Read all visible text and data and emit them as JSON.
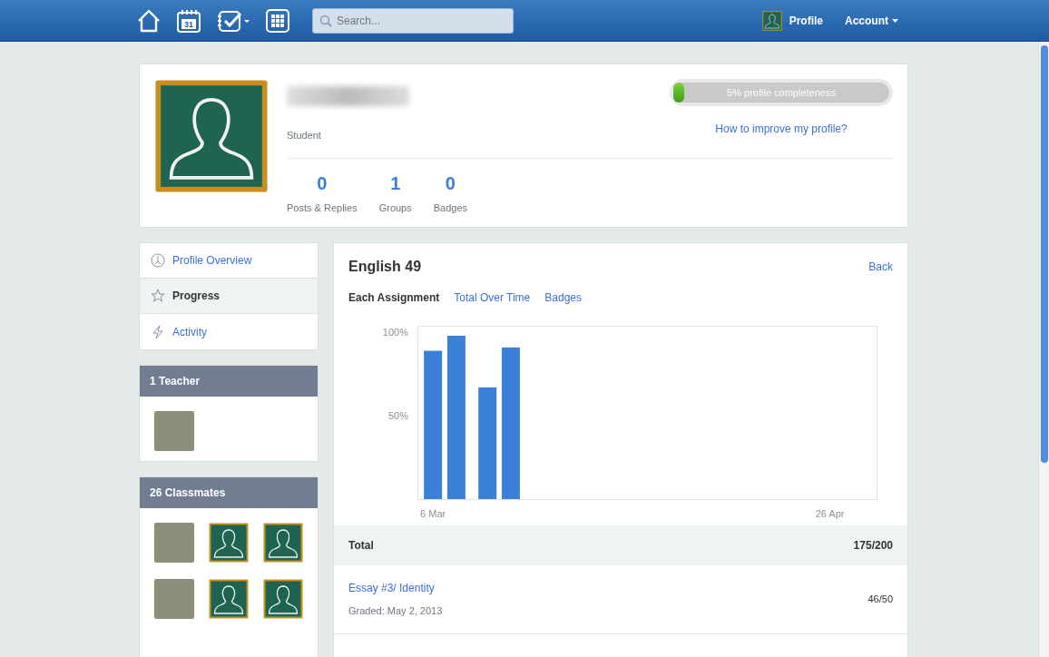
{
  "navbar": {
    "calendar_day": "31",
    "search": {
      "placeholder": "Search..."
    },
    "profile_label": "Profile",
    "account_label": "Account"
  },
  "profile": {
    "role": "Student",
    "completeness": {
      "label": "5% profile completeness",
      "level": 0.05
    },
    "improve_link": "How to improve my profile?",
    "stats": [
      {
        "value": "0",
        "label": "Posts & Replies"
      },
      {
        "value": "1",
        "label": "Groups"
      },
      {
        "value": "0",
        "label": "Badges"
      }
    ]
  },
  "sidebar": {
    "items": [
      {
        "label": "Profile Overview",
        "kind": "overview",
        "selected": false
      },
      {
        "label": "Progress",
        "kind": "progress",
        "selected": true
      },
      {
        "label": "Activity",
        "kind": "activity",
        "selected": false
      }
    ],
    "teachers": {
      "title": "1 Teacher",
      "members": [
        {
          "kind": "photo"
        }
      ]
    },
    "classmates": {
      "title": "26 Classmates",
      "members": [
        {
          "kind": "photo"
        },
        {
          "kind": "avatar"
        },
        {
          "kind": "avatar"
        },
        {
          "kind": "photo"
        },
        {
          "kind": "avatar"
        },
        {
          "kind": "avatar"
        }
      ]
    }
  },
  "course": {
    "title": "English 49",
    "back": "Back",
    "tabs": [
      {
        "label": "Each Assignment",
        "selected": true
      },
      {
        "label": "Total Over Time",
        "selected": false
      },
      {
        "label": "Badges",
        "selected": false
      }
    ],
    "chart_data": {
      "type": "bar",
      "x": [
        "2013-03-06",
        "2013-03-09",
        "2013-03-13",
        "2013-03-16"
      ],
      "values": [
        89,
        98,
        67,
        91
      ],
      "xlim": [
        "2013-03-04",
        "2013-05-02"
      ],
      "ylim": [
        0,
        104
      ],
      "yticks": [
        {
          "value": 50,
          "label": "50%"
        },
        {
          "value": 100,
          "label": "100%"
        }
      ],
      "xticks": [
        {
          "value": "2013-03-06",
          "label": "6 Mar"
        },
        {
          "value": "2013-04-26",
          "label": "26 Apr"
        }
      ]
    },
    "total": {
      "label": "Total",
      "score": "175/200"
    },
    "assignments": [
      {
        "title": "Essay #3/ Identity",
        "graded": "Graded: May 2, 2013",
        "score": "46/50"
      }
    ]
  }
}
